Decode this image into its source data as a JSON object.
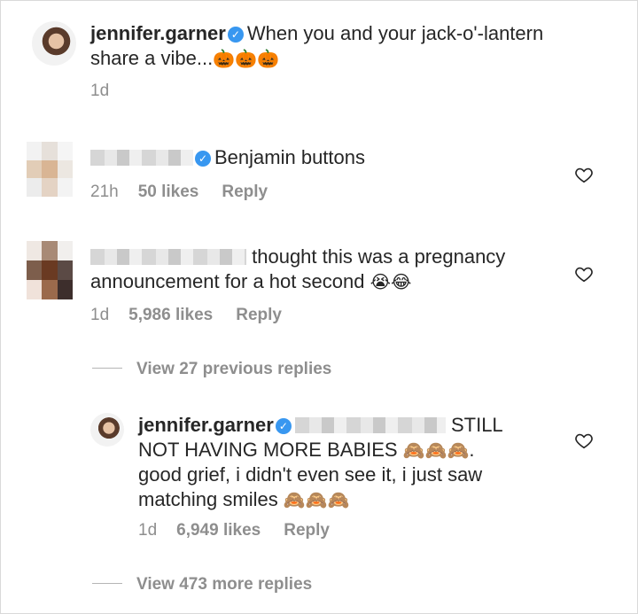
{
  "post": {
    "username": "jennifer.garner",
    "caption_line1": "When you and your jack-o'-lantern",
    "caption_line2": "share a vibe...",
    "caption_emoji": "🎃🎃🎃",
    "time": "1d"
  },
  "comments": [
    {
      "text_line1": "Benjamin buttons",
      "time": "21h",
      "likes": "50 likes",
      "reply_label": "Reply"
    },
    {
      "text_line1": "thought this was a pregnancy",
      "text_line2": "announcement for a hot second",
      "emoji": "😭😂",
      "time": "1d",
      "likes": "5,986 likes",
      "reply_label": "Reply"
    }
  ],
  "view_previous_label": "View 27 previous replies",
  "reply": {
    "username": "jennifer.garner",
    "text_line1": "STILL",
    "text_line2": "NOT HAVING MORE BABIES",
    "emoji_line2": "🙈🙈🙈",
    "text_line2_end": ".",
    "text_line3": "good grief, i didn't even see it, i just saw",
    "text_line4": "matching smiles",
    "emoji_line4": "🙈🙈🙈",
    "time": "1d",
    "likes": "6,949 likes",
    "reply_label": "Reply"
  },
  "view_more_label": "View 473 more replies",
  "icons": {
    "verified": "verified-badge-icon",
    "like": "heart-outline-icon"
  },
  "colors": {
    "verified": "#3897f0",
    "meta_text": "#8e8e8e"
  }
}
